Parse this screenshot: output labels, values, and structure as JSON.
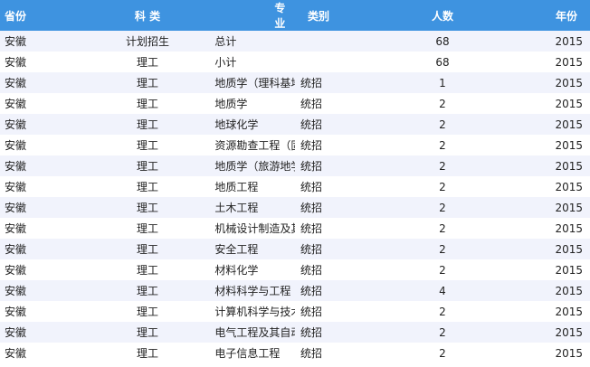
{
  "table": {
    "headers": {
      "province": "省份",
      "category": "科 类",
      "major": "专 业",
      "type": "类别",
      "count": "人数",
      "year": "年份"
    },
    "rows": [
      {
        "province": "安徽",
        "category": "计划招生",
        "major": "总计",
        "type": "",
        "count": "68",
        "year": "2015"
      },
      {
        "province": "安徽",
        "category": "理工",
        "major": "小计",
        "type": "",
        "count": "68",
        "year": "2015"
      },
      {
        "province": "安徽",
        "category": "理工",
        "major": "地质学（理科基地班）",
        "type": "统招",
        "count": "1",
        "year": "2015"
      },
      {
        "province": "安徽",
        "category": "理工",
        "major": "地质学",
        "type": "统招",
        "count": "2",
        "year": "2015"
      },
      {
        "province": "安徽",
        "category": "理工",
        "major": "地球化学",
        "type": "统招",
        "count": "2",
        "year": "2015"
      },
      {
        "province": "安徽",
        "category": "理工",
        "major": "资源勘查工程（固体矿产）",
        "type": "统招",
        "count": "2",
        "year": "2015"
      },
      {
        "province": "安徽",
        "category": "理工",
        "major": "地质学（旅游地学）",
        "type": "统招",
        "count": "2",
        "year": "2015"
      },
      {
        "province": "安徽",
        "category": "理工",
        "major": "地质工程",
        "type": "统招",
        "count": "2",
        "year": "2015"
      },
      {
        "province": "安徽",
        "category": "理工",
        "major": "土木工程",
        "type": "统招",
        "count": "2",
        "year": "2015"
      },
      {
        "province": "安徽",
        "category": "理工",
        "major": "机械设计制造及其自动化",
        "type": "统招",
        "count": "2",
        "year": "2015"
      },
      {
        "province": "安徽",
        "category": "理工",
        "major": "安全工程",
        "type": "统招",
        "count": "2",
        "year": "2015"
      },
      {
        "province": "安徽",
        "category": "理工",
        "major": "材料化学",
        "type": "统招",
        "count": "2",
        "year": "2015"
      },
      {
        "province": "安徽",
        "category": "理工",
        "major": "材料科学与工程",
        "type": "统招",
        "count": "4",
        "year": "2015"
      },
      {
        "province": "安徽",
        "category": "理工",
        "major": "计算机科学与技术",
        "type": "统招",
        "count": "2",
        "year": "2015"
      },
      {
        "province": "安徽",
        "category": "理工",
        "major": "电气工程及其自动化",
        "type": "统招",
        "count": "2",
        "year": "2015"
      },
      {
        "province": "安徽",
        "category": "理工",
        "major": "电子信息工程",
        "type": "统招",
        "count": "2",
        "year": "2015"
      }
    ]
  },
  "colors": {
    "header_bg": "#3e93e0",
    "row_alt_bg": "#f1f3fc"
  }
}
